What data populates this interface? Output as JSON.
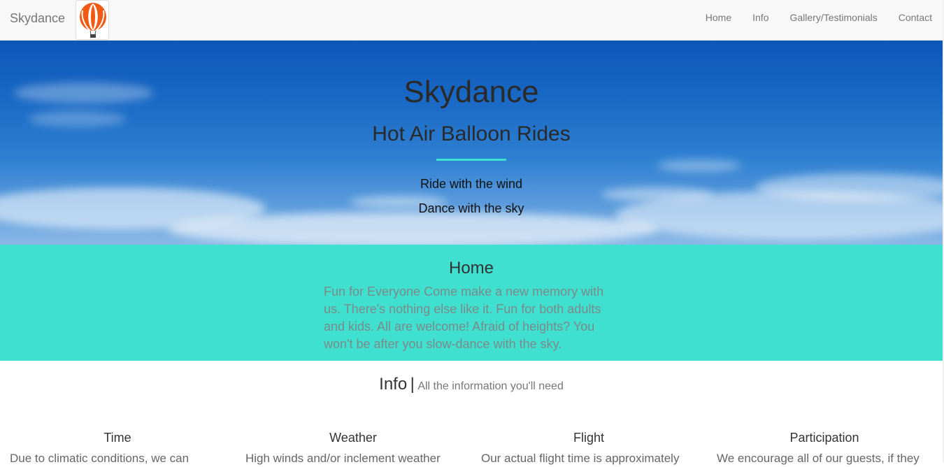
{
  "navbar": {
    "brand": "Skydance",
    "logo_icon": "hot-air-balloon-icon",
    "links": [
      "Home",
      "Info",
      "Gallery/Testimonials",
      "Contact"
    ]
  },
  "hero": {
    "title": "Skydance",
    "subtitle": "Hot Air Balloon Rides",
    "tagline_1": "Ride with the wind",
    "tagline_2": "Dance with the sky"
  },
  "home": {
    "title": "Home",
    "text": "Fun for Everyone Come make a new memory with us. There's nothing else like it. Fun for both adults and kids. All are welcome! Afraid of heights? You won't be after you slow-dance with the sky."
  },
  "info": {
    "title": "Info",
    "separator": "|",
    "subtitle": "All the information you'll need",
    "columns": [
      {
        "title": "Time",
        "text": "Due to climatic conditions, we can"
      },
      {
        "title": "Weather",
        "text": "High winds and/or inclement weather"
      },
      {
        "title": "Flight",
        "text": "Our actual flight time is approximately"
      },
      {
        "title": "Participation",
        "text": "We encourage all of our guests, if they"
      }
    ]
  },
  "colors": {
    "navbar_bg": "#f8f8f8",
    "accent_teal": "#40e0d0",
    "sky_blue": "#1a6ac6",
    "balloon_orange": "#f05a14"
  }
}
